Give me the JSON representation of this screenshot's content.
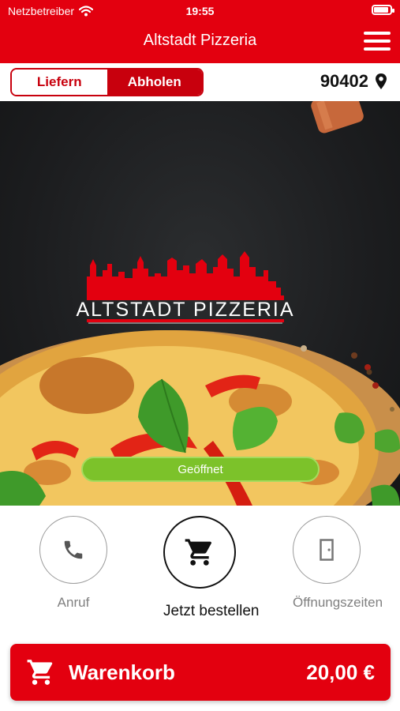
{
  "status_bar": {
    "carrier": "Netzbetreiber",
    "time": "19:55"
  },
  "header": {
    "title": "Altstadt Pizzeria"
  },
  "mode": {
    "deliver_label": "Liefern",
    "pickup_label": "Abholen",
    "selected": "pickup"
  },
  "location": {
    "zip": "90402"
  },
  "hero": {
    "logo_text": "ALTSTADT PIZZERIA",
    "status": "Geöffnet"
  },
  "actions": {
    "call_label": "Anruf",
    "order_label": "Jetzt bestellen",
    "hours_label": "Öffnungszeiten"
  },
  "cart": {
    "label": "Warenkorb",
    "total": "20,00 €"
  },
  "colors": {
    "brand_red": "#e3000f",
    "open_green": "#7cc22a"
  },
  "icons": [
    "wifi-icon",
    "battery-icon",
    "hamburger-menu-icon",
    "map-pin-icon",
    "phone-icon",
    "cart-icon",
    "door-icon"
  ]
}
